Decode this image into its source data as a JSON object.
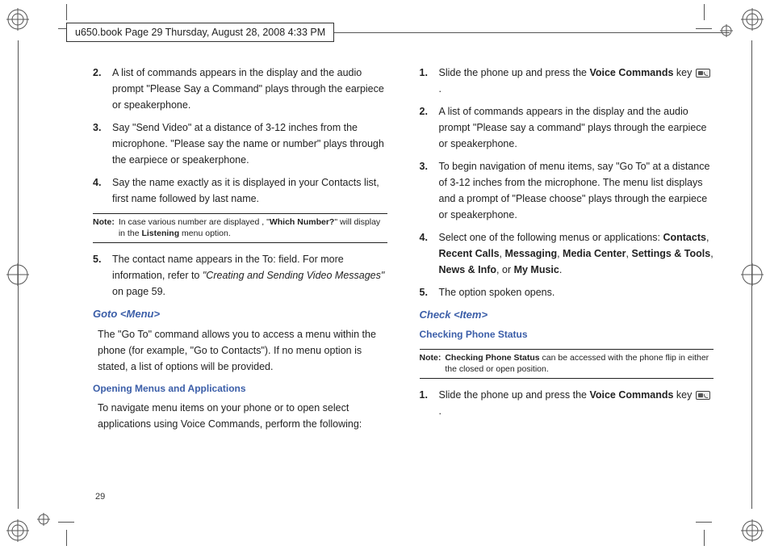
{
  "header": "u650.book  Page 29  Thursday, August 28, 2008  4:33 PM",
  "pageNumber": "29",
  "left": {
    "items": [
      {
        "num": "2.",
        "text": "A list of commands appears in the display and the audio prompt \"Please Say a Command\" plays through the earpiece or speakerphone."
      },
      {
        "num": "3.",
        "text": "Say \"Send Video\" at a distance of 3-12 inches from the microphone. \"Please say the name or number\" plays through the earpiece or speakerphone."
      },
      {
        "num": "4.",
        "text": "Say the name exactly as it is displayed in your Contacts list, first name followed by last name."
      }
    ],
    "note1": {
      "label": "Note:",
      "pre": "In case various number are displayed , \"",
      "bold": "Which Number?",
      "mid": "\" will display in the ",
      "bold2": "Listening",
      "post": " menu option."
    },
    "item5": {
      "num": "5.",
      "pre": "The contact name appears in the To: field. For more information, refer to ",
      "xref": "\"Creating and Sending Video Messages\"",
      "post": "  on page 59."
    },
    "h1": "Goto <Menu>",
    "p1": "The \"Go To\" command allows you to access a menu within the phone (for example, \"Go to Contacts\"). If no menu option is stated, a list of options will be provided.",
    "h2": "Opening Menus and Applications",
    "p2": "To navigate menu items on your phone or to open select applications using Voice Commands, perform the following:"
  },
  "right": {
    "r1": {
      "num": "1.",
      "pre": "Slide the phone up and press the ",
      "bold": "Voice Commands",
      "post": " key ",
      "dot": "."
    },
    "r2": {
      "num": "2.",
      "text": "A list of commands appears in the display and the audio prompt \"Please say a command\" plays through the earpiece or speakerphone."
    },
    "r3": {
      "num": "3.",
      "text": "To begin navigation of menu items, say \"Go To\" at a distance of 3-12 inches from the microphone. The menu list displays and a prompt of \"Please choose\" plays through the earpiece or speakerphone."
    },
    "r4": {
      "num": "4.",
      "pre": "Select one of the following menus or applications: ",
      "b1": "Contacts",
      "c1": ", ",
      "b2": "Recent Calls",
      "c2": ", ",
      "b3": "Messaging",
      "c3": ", ",
      "b4": "Media Center",
      "c4": ", ",
      "b5": "Settings & Tools",
      "c5": ", ",
      "b6": "News & Info",
      "c6": ", or ",
      "b7": "My Music",
      "c7": "."
    },
    "r5": {
      "num": "5.",
      "text": "The option spoken opens."
    },
    "h1": "Check <Item>",
    "h2": "Checking Phone Status",
    "note": {
      "label": "Note:",
      "bold": "Checking Phone Status",
      "post": " can be accessed with the phone flip in either the closed or open position."
    },
    "s1": {
      "num": "1.",
      "pre": "Slide the phone up and press the ",
      "bold": "Voice Commands",
      "post": " key ",
      "dot": "."
    }
  }
}
